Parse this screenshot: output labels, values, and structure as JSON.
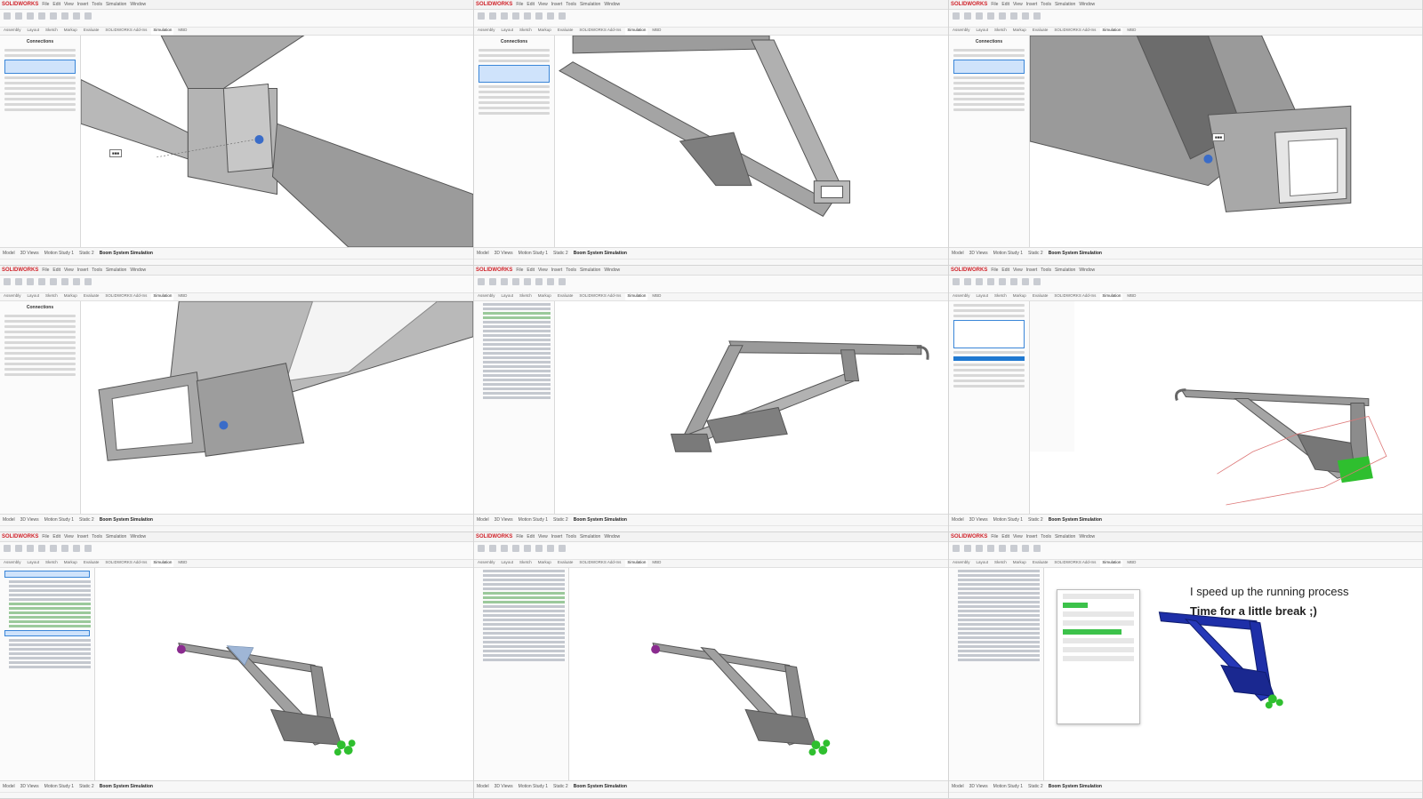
{
  "app": {
    "brand": "SOLIDWORKS",
    "menu": [
      "File",
      "Edit",
      "View",
      "Insert",
      "Tools",
      "Simulation",
      "Window"
    ]
  },
  "command_tabs": [
    "Assembly",
    "Layout",
    "Sketch",
    "Markup",
    "Evaluate",
    "SOLIDWORKS Add-Ins",
    "Simulation",
    "MBD"
  ],
  "bottom_tabs": [
    "Model",
    "3D Views",
    "Motion Study 1",
    "Static 2",
    "Boom System Simulation"
  ],
  "panel": {
    "title_connections": "Connections"
  },
  "overlay": {
    "line1": "I speed up the running process",
    "line2": "Time for a little break ;)"
  },
  "colors": {
    "brand_red": "#d0232a",
    "selection_blue": "#1f78d1",
    "fixture_green": "#2fbf2f",
    "mesh_blue": "#1e2fa8",
    "load_purple": "#8a2b8f",
    "steel_gray": "#8d8d8d"
  }
}
